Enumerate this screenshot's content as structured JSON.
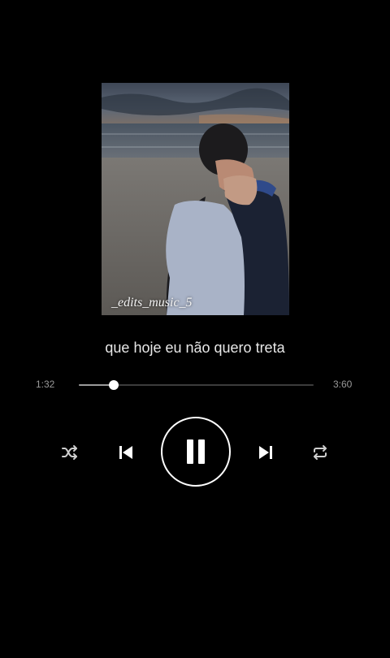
{
  "player": {
    "cover_watermark": "_edits_music_5",
    "lyric": "que hoje eu não quero treta",
    "elapsed": "1:32",
    "total": "3:60",
    "progress_fraction": 0.15,
    "state": "playing"
  },
  "controls": {
    "shuffle": "shuffle-icon",
    "previous": "skip-previous-icon",
    "play_pause": "pause-icon",
    "next": "skip-next-icon",
    "repeat": "repeat-icon"
  },
  "colors": {
    "background": "#000000",
    "text": "#e8e8e8",
    "muted": "#9a9a9a",
    "track": "#3c3c3c"
  }
}
